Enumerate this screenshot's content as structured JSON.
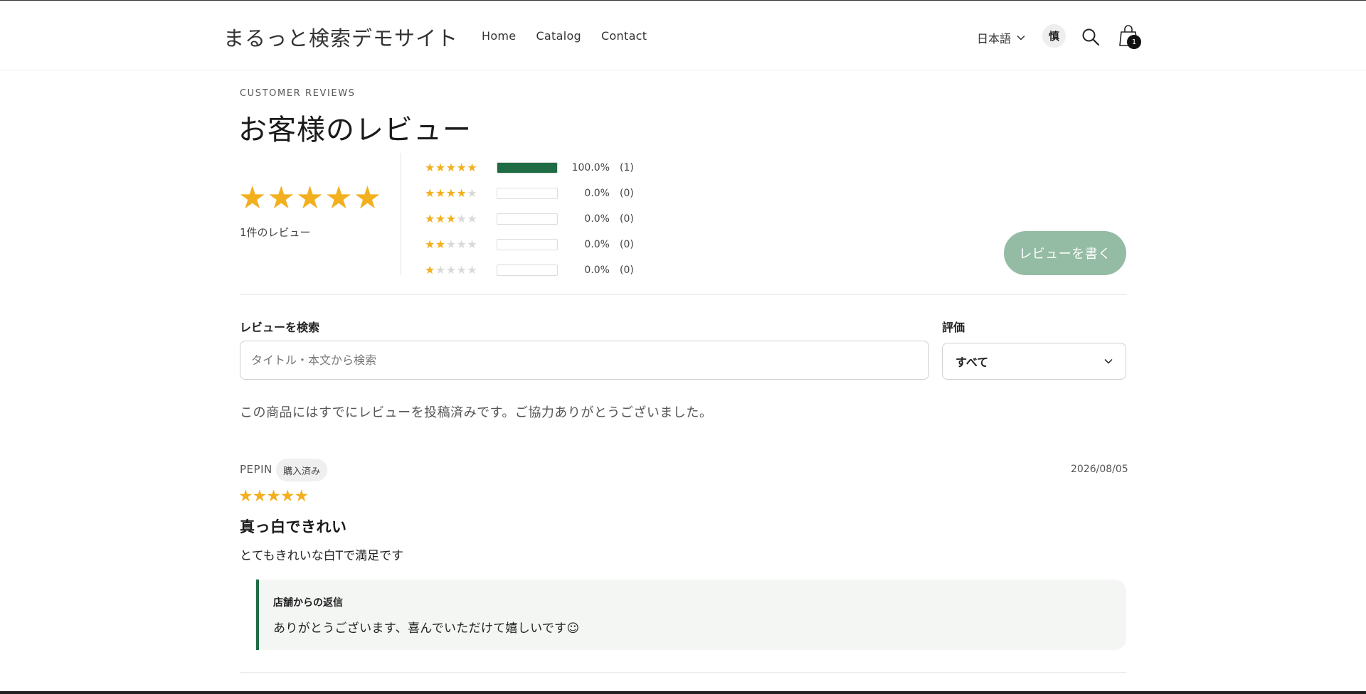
{
  "header": {
    "logo": "まるっと検索デモサイト",
    "nav": [
      {
        "label": "Home"
      },
      {
        "label": "Catalog"
      },
      {
        "label": "Contact"
      }
    ],
    "language": "日本語",
    "user_initial": "慎",
    "cart_count": "1"
  },
  "reviews": {
    "eyebrow": "CUSTOMER REVIEWS",
    "title": "お客様のレビュー",
    "average_rating": 5,
    "summary_stars": "★★★★★",
    "count_label": "1件のレビュー",
    "distribution": [
      {
        "stars": 5,
        "fraction": 1.0,
        "percent": "100.0%",
        "count": "(1)"
      },
      {
        "stars": 4,
        "fraction": 0.0,
        "percent": "0.0%",
        "count": "(0)"
      },
      {
        "stars": 3,
        "fraction": 0.0,
        "percent": "0.0%",
        "count": "(0)"
      },
      {
        "stars": 2,
        "fraction": 0.0,
        "percent": "0.0%",
        "count": "(0)"
      },
      {
        "stars": 1,
        "fraction": 0.0,
        "percent": "0.0%",
        "count": "(0)"
      }
    ],
    "write_button": "レビューを書く",
    "search_label": "レビューを検索",
    "search_placeholder": "タイトル・本文から検索",
    "search_value": "",
    "rating_label": "評価",
    "rating_selected": "すべて",
    "notice": "この商品にはすでにレビューを投稿済みです。ご協力ありがとうございました。",
    "items": [
      {
        "author": "PEPIN",
        "badge": "購入済み",
        "date": "2026/08/05",
        "rating": 5,
        "stars": "★★★★★",
        "title": "真っ白できれい",
        "body": "とてもきれいな白Tで満足です",
        "reply_label": "店舗からの返信",
        "reply_text": "ありがとうございます、喜んでいただけて嬉しいです☺"
      }
    ]
  },
  "colors": {
    "star": "#f2b01e",
    "accent_green": "#1e6b44",
    "button_green": "#94bba4"
  }
}
